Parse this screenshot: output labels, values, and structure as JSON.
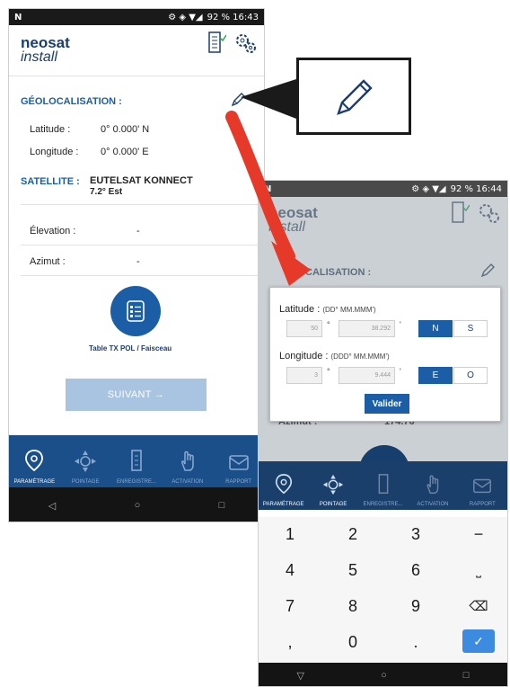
{
  "screen1": {
    "status": {
      "left": "N",
      "right": "92 %  16:43"
    },
    "logo": {
      "line1": "neosat",
      "line2": "install"
    },
    "geo_title": "GÉOLOCALISATION :",
    "latitude_label": "Latitude :",
    "latitude_value": "0° 0.000' N",
    "longitude_label": "Longitude :",
    "longitude_value": "0° 0.000' E",
    "satellite_label": "SATELLITE :",
    "satellite_name": "EUTELSAT KONNECT",
    "satellite_pos": "7.2° Est",
    "elevation_label": "Élevation :",
    "elevation_value": "-",
    "azimut_label": "Azimut :",
    "azimut_value": "-",
    "table_label": "Table TX POL / Faisceau",
    "next_label": "SUIVANT  →",
    "tabs": [
      "PARAMÉTRAGE",
      "POINTAGE",
      "ENREGISTRE...",
      "ACTIVATION",
      "RAPPORT"
    ],
    "nav": [
      "◁",
      "○",
      "□"
    ]
  },
  "screen2": {
    "status": {
      "left": "N",
      "right": "92 %  16:44"
    },
    "logo": {
      "line1": "neosat",
      "line2": "install"
    },
    "geo_title_partial": "CALISATION :",
    "lat_label": "Latitude :",
    "lat_format": "(DD° MM.MMM')",
    "lat_deg": "50",
    "lat_min": "38.292",
    "lat_hemis": [
      "N",
      "S"
    ],
    "lon_label": "Longitude :",
    "lon_format": "(DDD° MM.MMM')",
    "lon_deg": "3",
    "lon_min": "9.444",
    "lon_hemis": [
      "E",
      "O"
    ],
    "validate_label": "Valider",
    "azimut_partial": "Azimut :",
    "azimut_value_partial": "174.76",
    "tabs": [
      "PARAMÉTRAGE",
      "POINTAGE",
      "ENREGISTRE...",
      "ACTIVATION",
      "RAPPORT"
    ],
    "keys": [
      "1",
      "2",
      "3",
      "−",
      "4",
      "5",
      "6",
      "⎵",
      "7",
      "8",
      "9",
      "⌫",
      ",",
      "0",
      ".",
      "✓"
    ],
    "nav": [
      "▽",
      "○",
      "□"
    ]
  },
  "colors": {
    "brand": "#1b5ea6",
    "tab_bar": "#1b4f8a",
    "arrow": "#e53a2a"
  },
  "icons": [
    "pen-icon",
    "gear-icon",
    "meter-icon",
    "location-pin-icon",
    "pointing-icon",
    "recorder-icon",
    "hand-icon",
    "mail-icon",
    "list-icon"
  ]
}
